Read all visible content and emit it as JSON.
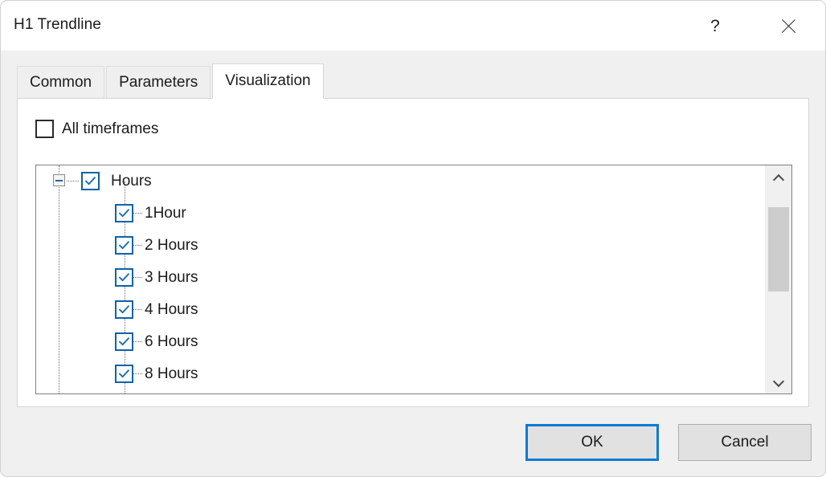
{
  "window": {
    "title": "H1 Trendline",
    "help_glyph": "?",
    "close_icon": "close-icon"
  },
  "tabs": [
    {
      "label": "Common",
      "active": false
    },
    {
      "label": "Parameters",
      "active": false
    },
    {
      "label": "Visualization",
      "active": true
    }
  ],
  "panel": {
    "all_timeframes": {
      "label": "All timeframes",
      "checked": false
    },
    "tree": {
      "root": {
        "label": "Hours",
        "checked": true,
        "expanded": true
      },
      "children": [
        {
          "label": "1Hour",
          "checked": true
        },
        {
          "label": "2 Hours",
          "checked": true
        },
        {
          "label": "3 Hours",
          "checked": true
        },
        {
          "label": "4 Hours",
          "checked": true
        },
        {
          "label": "6 Hours",
          "checked": true
        },
        {
          "label": "8 Hours",
          "checked": true
        }
      ],
      "scrollbar": {
        "up_arrow": "chevron-up-icon",
        "down_arrow": "chevron-down-icon"
      }
    }
  },
  "footer": {
    "ok_label": "OK",
    "cancel_label": "Cancel"
  },
  "colors": {
    "accent": "#0b7ad4",
    "checkbox_border": "#0f62a8",
    "checkmark": "#1f6fb5",
    "window_background": "#f0f0f0",
    "panel_background": "#ffffff",
    "tree_border": "#7c8088",
    "scrollbar_thumb": "#cdcdcd",
    "button_face": "#e1e1e1"
  }
}
